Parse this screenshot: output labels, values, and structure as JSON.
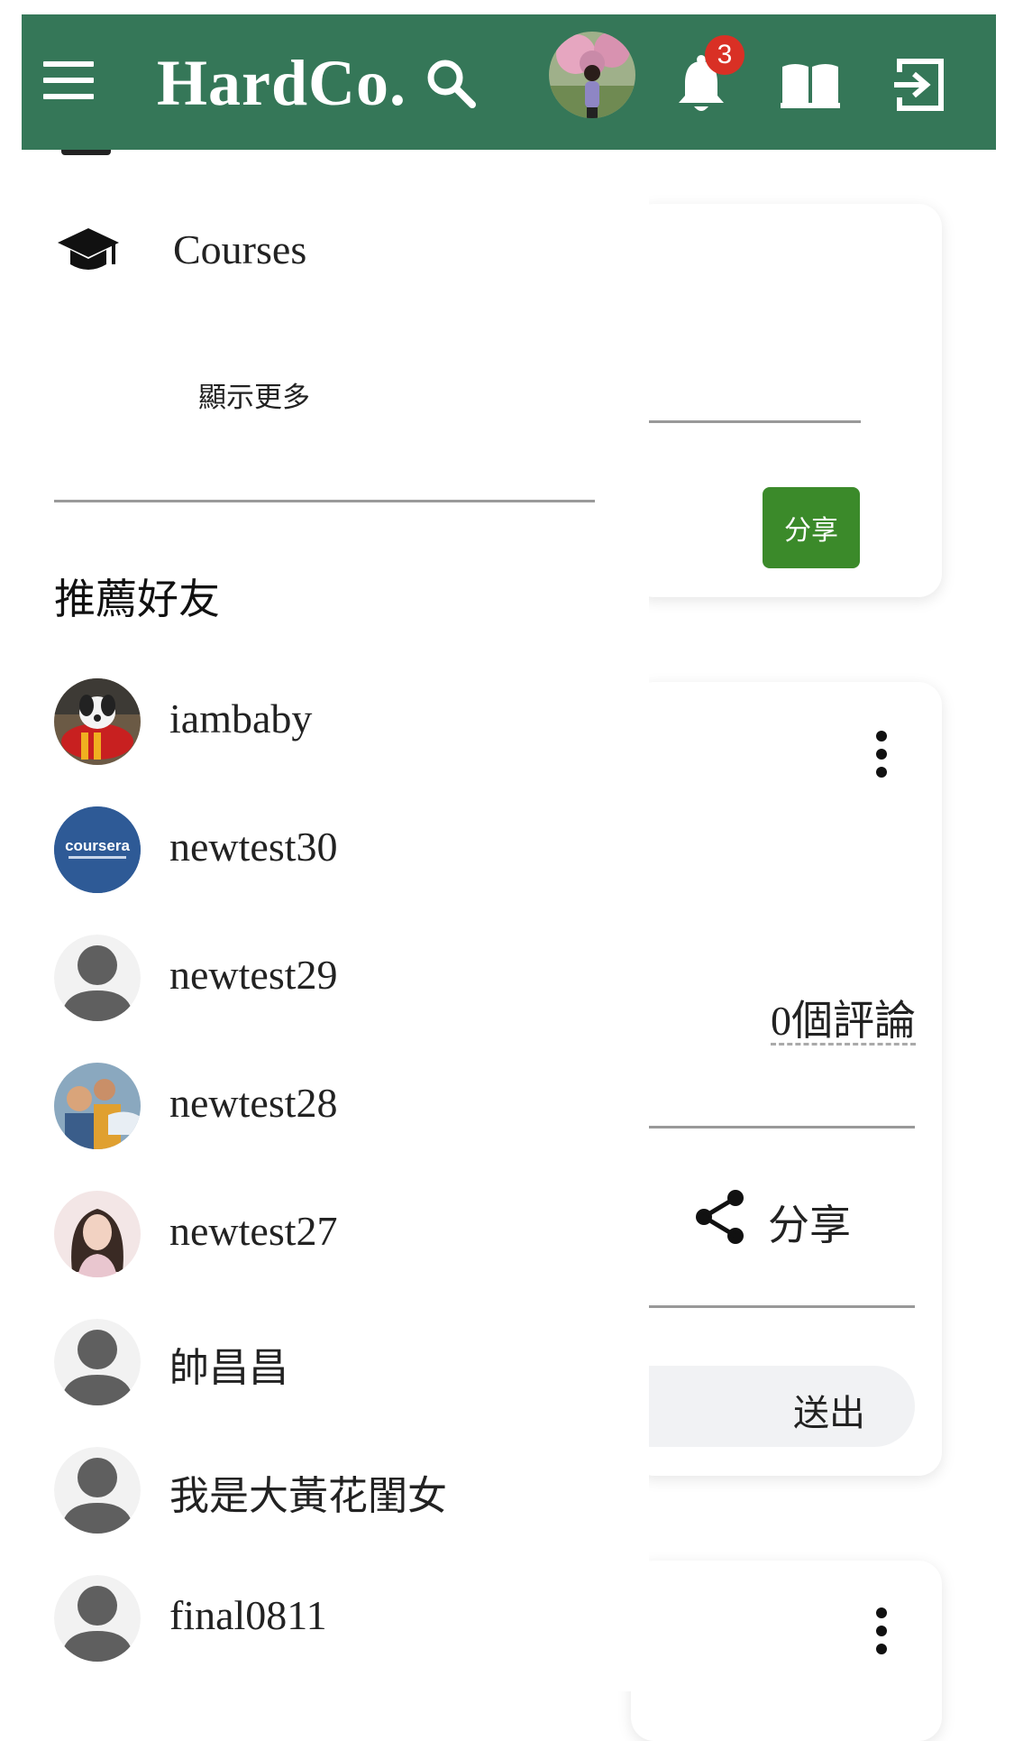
{
  "header": {
    "brand": "HardCo.",
    "notification_count": "3",
    "bar_color": "#357758"
  },
  "drawer": {
    "courses_label": "Courses",
    "show_more_label": "顯示更多",
    "section_title": "推薦好友",
    "friends": [
      {
        "name": "iambaby",
        "avatar": "photo-dog"
      },
      {
        "name": "newtest30",
        "avatar": "coursera-logo",
        "avatar_text": "coursera"
      },
      {
        "name": "newtest29",
        "avatar": "default-user-icon"
      },
      {
        "name": "newtest28",
        "avatar": "photo-group"
      },
      {
        "name": "newtest27",
        "avatar": "photo-woman"
      },
      {
        "name": "帥昌昌",
        "avatar": "default-user-icon"
      },
      {
        "name": "我是大黃花閨女",
        "avatar": "default-user-icon"
      },
      {
        "name": "final0811",
        "avatar": "default-user-icon"
      }
    ]
  },
  "feed": {
    "share_button_label": "分享",
    "comments_count": "0個評論",
    "share_action_label": "分享",
    "send_label": "送出",
    "accent_green": "#3b8a2a"
  }
}
